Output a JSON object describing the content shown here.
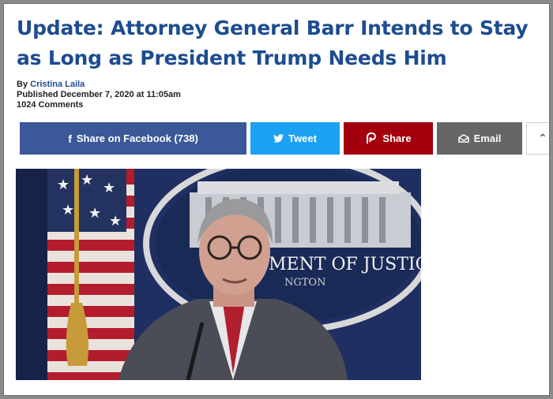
{
  "article": {
    "headline": "Update: Attorney General Barr Intends to Stay as Long as President Trump Needs Him",
    "byline_prefix": "By ",
    "author": "Cristina Laila",
    "published": "Published December 7, 2020 at 11:05am",
    "comments": "1024 Comments"
  },
  "share": {
    "facebook_label": "Share on Facebook (738)",
    "twitter_label": "Tweet",
    "parler_label": "Share",
    "email_label": "Email"
  },
  "photo": {
    "seal_line1": "MENT OF JUSTICE",
    "seal_line2": "NGTON"
  },
  "colors": {
    "headline": "#1d4c8f",
    "facebook": "#3b5998",
    "twitter": "#1da1f2",
    "parler": "#a3000e",
    "email": "#666666"
  },
  "icons": {
    "facebook": "facebook-icon",
    "twitter": "twitter-icon",
    "parler": "parler-icon",
    "email": "envelope-icon",
    "more": "chevron-up-icon"
  }
}
